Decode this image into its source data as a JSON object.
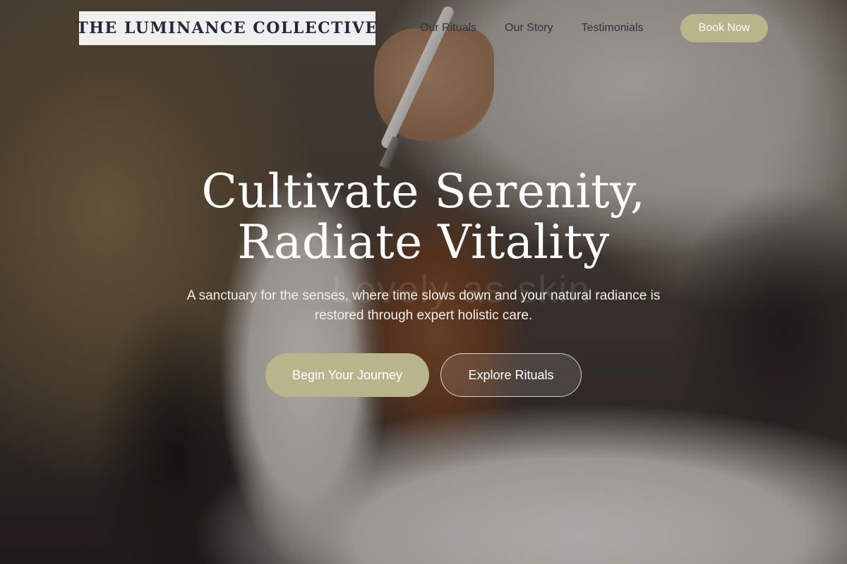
{
  "brand": {
    "name": "THE LUMINANCE COLLECTIVE"
  },
  "nav": {
    "items": [
      {
        "label": "Our Rituals"
      },
      {
        "label": "Our Story"
      },
      {
        "label": "Testimonials"
      }
    ],
    "book_label": "Book Now"
  },
  "hero": {
    "headline_line1": "Cultivate Serenity,",
    "headline_line2": "Radiate Vitality",
    "ghost_text": "Lovely as skin",
    "subtitle": "A sanctuary for the senses, where time slows down and your natural radiance is restored through expert holistic care.",
    "primary_cta": "Begin Your Journey",
    "secondary_cta": "Explore Rituals"
  },
  "colors": {
    "accent": "#b8b48c",
    "logo_text": "#222a3a",
    "nav_text": "#2e3340",
    "hero_text": "#ffffff"
  },
  "background_image": {
    "subject": "facial-treatment-photo"
  }
}
